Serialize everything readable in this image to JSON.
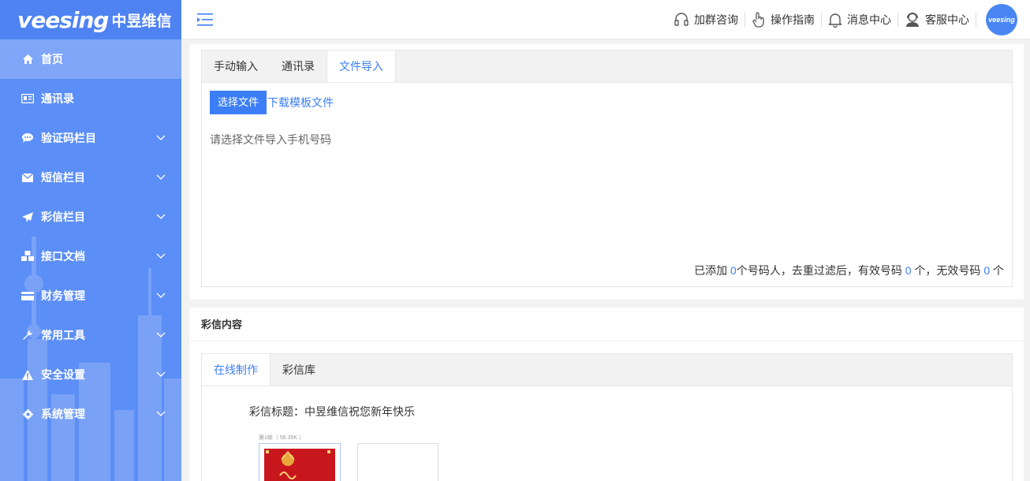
{
  "sidebar": {
    "brand": "veesing",
    "brand_cn": "中昱维信",
    "items": [
      {
        "label": "首页",
        "icon": "home-icon",
        "active": true
      },
      {
        "label": "通讯录",
        "icon": "contacts-card-icon"
      },
      {
        "label": "验证码栏目",
        "icon": "chat-bubble-icon"
      },
      {
        "label": "短信栏目",
        "icon": "envelope-icon"
      },
      {
        "label": "彩信栏目",
        "icon": "paper-plane-icon"
      },
      {
        "label": "接口文档",
        "icon": "cubes-icon"
      },
      {
        "label": "财务管理",
        "icon": "credit-card-icon"
      },
      {
        "label": "常用工具",
        "icon": "wrench-icon"
      },
      {
        "label": "安全设置",
        "icon": "warning-icon"
      },
      {
        "label": "系统管理",
        "icon": "gear-icon"
      }
    ]
  },
  "header": {
    "links": [
      {
        "label": "加群咨询",
        "icon": "headset-icon"
      },
      {
        "label": "操作指南",
        "icon": "pointing-hand-icon"
      },
      {
        "label": "消息中心",
        "icon": "bell-icon"
      },
      {
        "label": "客服中心",
        "icon": "support-agent-icon"
      }
    ],
    "avatar_text": "veesing"
  },
  "import_panel": {
    "tabs": [
      "手动输入",
      "通讯录",
      "文件导入"
    ],
    "active_tab": 2,
    "choose_file_label": "选择文件",
    "download_template_label": "下载模板文件",
    "hint": "请选择文件导入手机号码",
    "stats": {
      "prefix": "已添加 ",
      "added": "0",
      "mid1": "个号码人，去重过滤后，有效号码 ",
      "valid": "0",
      "mid2": " 个，无效号码 ",
      "invalid": "0",
      "suffix": " 个"
    }
  },
  "mms_panel": {
    "title": "彩信内容",
    "tabs": [
      "在线制作",
      "彩信库"
    ],
    "active_tab": 0,
    "mms_title": "彩信标题：中昱维信祝您新年快乐",
    "frame_label": "第1帧（ 56.35K ）"
  },
  "colors": {
    "sidebar_bg": "#5b8ef6",
    "accent": "#3b7ef6"
  }
}
